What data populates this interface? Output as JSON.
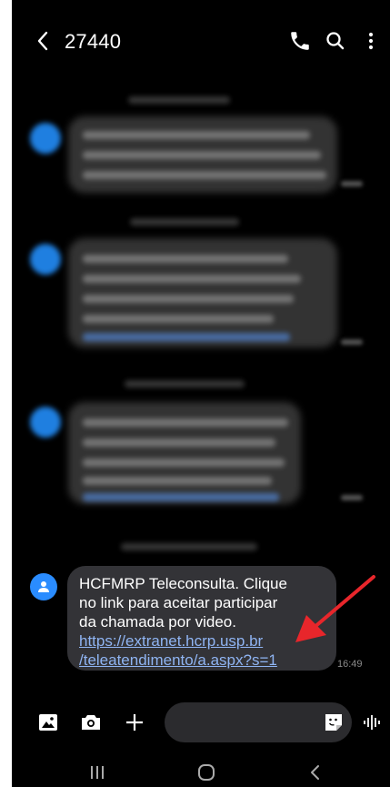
{
  "header": {
    "title": "27440",
    "icons": [
      "back-arrow-icon",
      "phone-icon",
      "search-icon",
      "more-options-icon"
    ]
  },
  "last_message": {
    "lines": [
      "HCFMRP Teleconsulta. Clique",
      "no link para aceitar participar",
      "da chamada por video."
    ],
    "link_lines": [
      "https://extranet.hcrp.usp.br",
      "/teleatendimento/a.aspx?s=1"
    ],
    "time": "16:49"
  },
  "input_bar": {
    "icons": [
      "gallery-icon",
      "camera-icon",
      "plus-icon",
      "sticker-icon",
      "voice-icon"
    ]
  },
  "nav_bar": {
    "icons": [
      "recent-apps-icon",
      "home-icon",
      "back-icon"
    ]
  },
  "colors": {
    "background": "#000000",
    "bubble": "#333337",
    "link": "#8fb4f2",
    "avatar": "#2a8cff",
    "annotation_arrow": "#e8262b"
  }
}
